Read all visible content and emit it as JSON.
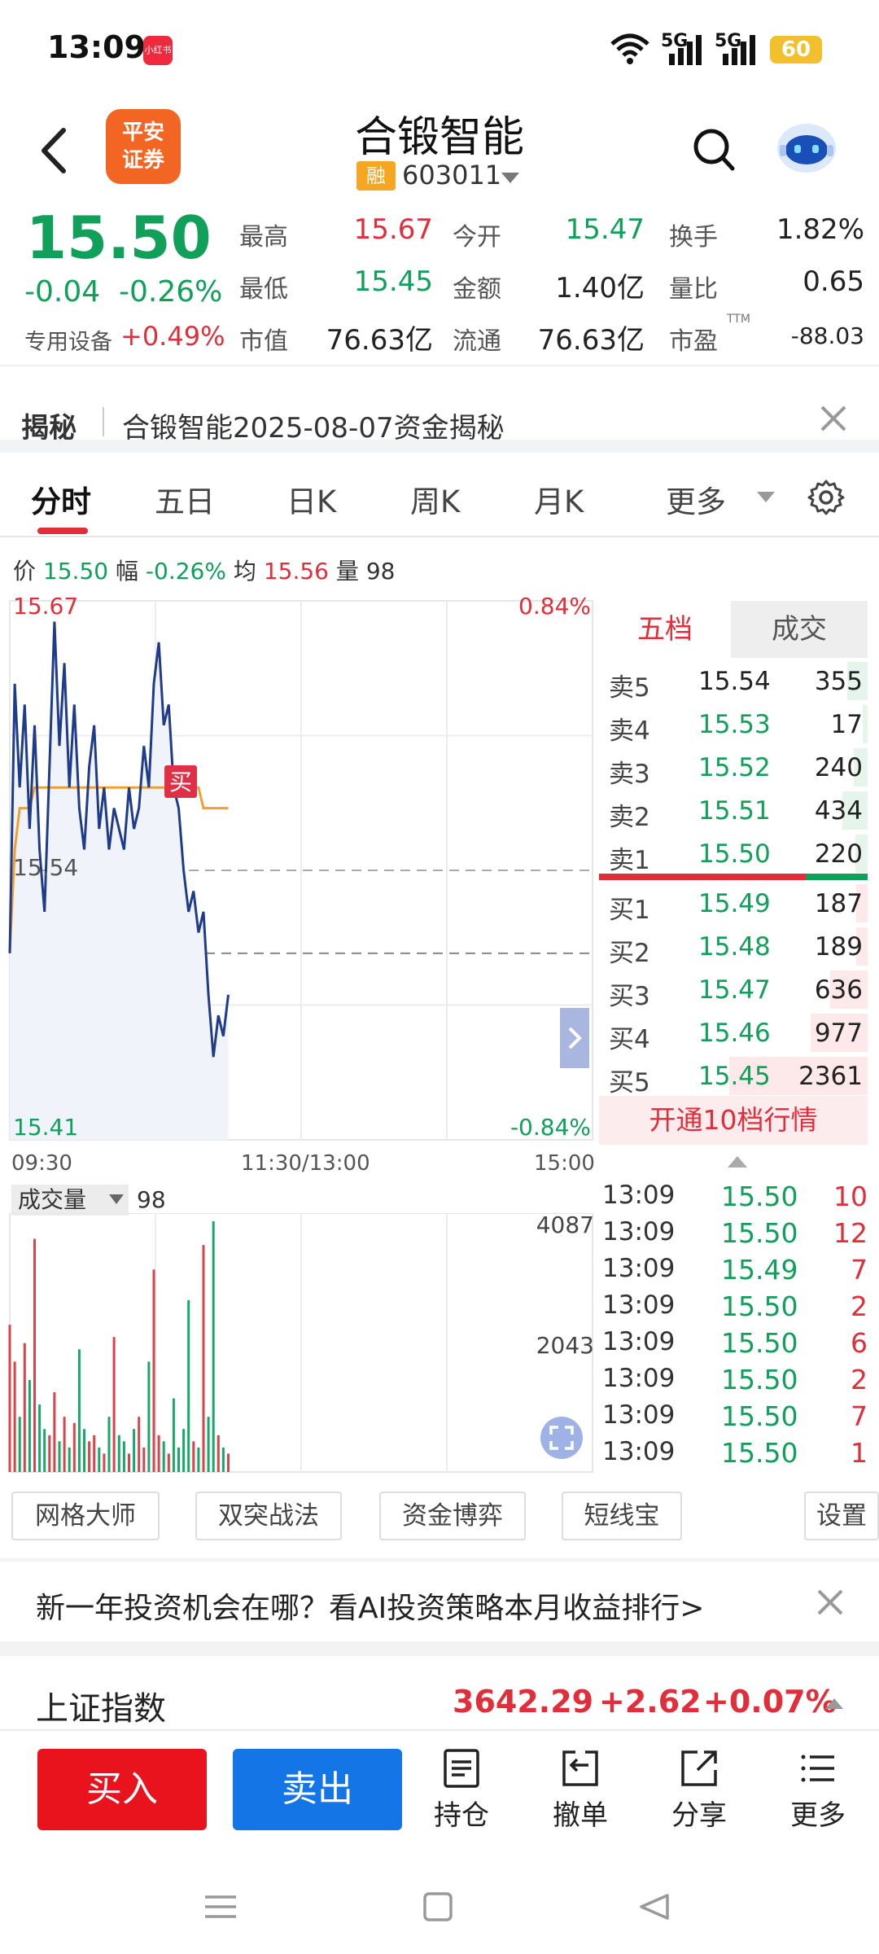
{
  "status": {
    "time": "13:09",
    "app_badge": "小红书",
    "net1": "5G",
    "net2": "5G",
    "battery": "60"
  },
  "header": {
    "logo_line1": "平安",
    "logo_line2": "证券",
    "stock_name": "合锻智能",
    "margin_badge": "融",
    "stock_code": "603011"
  },
  "quote": {
    "price": "15.50",
    "change": "-0.04",
    "change_pct": "-0.26%",
    "industry": "专用设备",
    "industry_change": "+0.49%",
    "ttm_label": "TTM",
    "rows": [
      [
        {
          "label": "最高",
          "value": "15.67",
          "color": "#e02e3a"
        },
        {
          "label": "今开",
          "value": "15.47",
          "color": "#10a05a"
        },
        {
          "label": "换手",
          "value": "1.82%",
          "color": "#222222"
        }
      ],
      [
        {
          "label": "最低",
          "value": "15.45",
          "color": "#10a05a"
        },
        {
          "label": "金额",
          "value": "1.40亿",
          "color": "#222222"
        },
        {
          "label": "量比",
          "value": "0.65",
          "color": "#222222"
        }
      ],
      [
        {
          "label": "市值",
          "value": "76.63亿",
          "color": "#222222"
        },
        {
          "label": "流通",
          "value": "76.63亿",
          "color": "#222222"
        },
        {
          "label": "市盈",
          "value": "-88.03",
          "color": "#222222"
        }
      ]
    ]
  },
  "news": {
    "tag": "揭秘",
    "text": "合锻智能2025-08-07资金揭秘"
  },
  "tabs": [
    {
      "label": "分时",
      "active": true
    },
    {
      "label": "五日",
      "active": false
    },
    {
      "label": "日K",
      "active": false
    },
    {
      "label": "周K",
      "active": false
    },
    {
      "label": "月K",
      "active": false
    },
    {
      "label": "更多",
      "active": false
    }
  ],
  "info_line": {
    "price_label": "价",
    "price": "15.50",
    "amp_label": "幅",
    "amp": "-0.26%",
    "avg_label": "均",
    "avg": "15.56",
    "vol_label": "量",
    "vol": "98"
  },
  "chart": {
    "top_price": "15.67",
    "top_pct": "0.84%",
    "mid_price": "15.54",
    "bottom_price": "15.41",
    "bottom_pct": "-0.84%",
    "buy_marker": "买",
    "time_start": "09:30",
    "time_mid": "11:30/13:00",
    "time_end": "15:00"
  },
  "volume": {
    "label": "成交量",
    "value": "98",
    "y_high": "4087",
    "y_mid": "2043"
  },
  "order_book": {
    "tab_levels": "五档",
    "tab_trades": "成交",
    "asks": [
      {
        "label": "卖5",
        "price": "15.54",
        "vol": "355",
        "bar": 0.15
      },
      {
        "label": "卖4",
        "price": "15.53",
        "vol": "17",
        "bar": 0.01
      },
      {
        "label": "卖3",
        "price": "15.52",
        "vol": "240",
        "bar": 0.1
      },
      {
        "label": "卖2",
        "price": "15.51",
        "vol": "434",
        "bar": 0.18
      },
      {
        "label": "卖1",
        "price": "15.50",
        "vol": "220",
        "bar": 0.09
      }
    ],
    "bids": [
      {
        "label": "买1",
        "price": "15.49",
        "vol": "187",
        "bar": 0.08
      },
      {
        "label": "买2",
        "price": "15.48",
        "vol": "189",
        "bar": 0.08
      },
      {
        "label": "买3",
        "price": "15.47",
        "vol": "636",
        "bar": 0.27
      },
      {
        "label": "买4",
        "price": "15.46",
        "vol": "977",
        "bar": 0.41
      },
      {
        "label": "买5",
        "price": "15.45",
        "vol": "2361",
        "bar": 1.0
      }
    ],
    "open10": "开通10档行情"
  },
  "trades": [
    {
      "time": "13:09",
      "price": "15.50",
      "vol": "10"
    },
    {
      "time": "13:09",
      "price": "15.50",
      "vol": "12"
    },
    {
      "time": "13:09",
      "price": "15.49",
      "vol": "7"
    },
    {
      "time": "13:09",
      "price": "15.50",
      "vol": "2"
    },
    {
      "time": "13:09",
      "price": "15.50",
      "vol": "6"
    },
    {
      "time": "13:09",
      "price": "15.50",
      "vol": "2"
    },
    {
      "time": "13:09",
      "price": "15.50",
      "vol": "7"
    },
    {
      "time": "13:09",
      "price": "15.50",
      "vol": "1"
    }
  ],
  "tools": [
    "网格大师",
    "双突战法",
    "资金博弈",
    "短线宝",
    "设置"
  ],
  "promo": "新一年投资机会在哪？看AI投资策略本月收益排行>",
  "index": {
    "name": "上证指数",
    "value": "3642.29",
    "change": "+2.62",
    "change_pct": "+0.07%"
  },
  "actions": {
    "buy": "买入",
    "sell": "卖出",
    "position": "持仓",
    "cancel": "撤单",
    "share": "分享",
    "more": "更多"
  },
  "colors": {
    "up": "#e02e3a",
    "down": "#10a05a",
    "price_line": "#1f3b8c",
    "avg_line": "#f0a030"
  },
  "chart_data": {
    "type": "line",
    "series": [
      {
        "values": [
          15.5,
          15.63,
          15.58,
          15.62,
          15.56,
          15.61,
          15.55,
          15.52,
          15.59,
          15.66,
          15.6,
          15.64,
          15.58,
          15.62,
          15.57,
          15.55,
          15.59,
          15.61,
          15.56,
          15.58,
          15.55,
          15.57,
          15.56,
          15.55,
          15.58,
          15.56,
          15.57,
          15.6,
          15.58,
          15.63,
          15.65,
          15.61,
          15.62,
          15.58,
          15.57,
          15.54,
          15.52,
          15.53,
          15.51,
          15.52,
          15.48,
          15.45,
          15.47,
          15.46,
          15.48
        ]
      },
      {
        "values": [
          15.5,
          15.55,
          15.57,
          15.57,
          15.57,
          15.58,
          15.58,
          15.58,
          15.58,
          15.58,
          15.58,
          15.58,
          15.58,
          15.58,
          15.58,
          15.58,
          15.58,
          15.58,
          15.58,
          15.58,
          15.58,
          15.58,
          15.58,
          15.58,
          15.58,
          15.58,
          15.58,
          15.58,
          15.58,
          15.58,
          15.58,
          15.58,
          15.58,
          15.58,
          15.58,
          15.58,
          15.58,
          15.58,
          15.58,
          15.57,
          15.57,
          15.57,
          15.57,
          15.57,
          15.57
        ]
      }
    ],
    "ylim": [
      15.41,
      15.67
    ],
    "volume": [
      2400,
      1800,
      900,
      2100,
      1500,
      3800,
      1100,
      700,
      600,
      1300,
      500,
      900,
      400,
      800,
      2000,
      700,
      500,
      600,
      400,
      300,
      900,
      2200,
      600,
      500,
      300,
      700,
      900,
      400,
      1800,
      3300,
      600,
      500,
      300,
      1200,
      400,
      700,
      2800,
      500,
      400,
      3700,
      900,
      4087,
      600,
      400,
      300
    ],
    "volume_ylim": [
      0,
      4087
    ]
  }
}
